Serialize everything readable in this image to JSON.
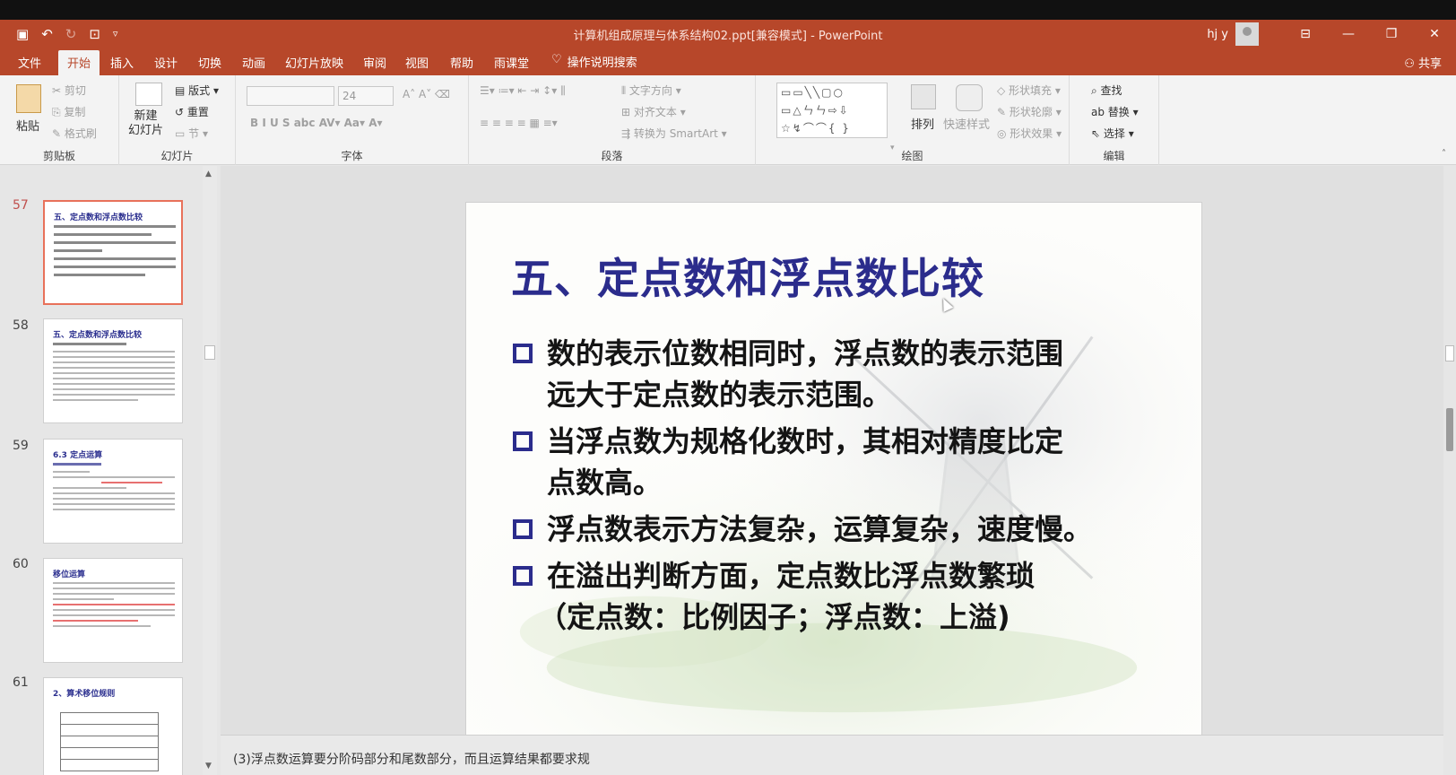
{
  "window": {
    "title": "计算机组成原理与体系结构02.ppt[兼容模式] - PowerPoint",
    "user": "hj y"
  },
  "tabs": [
    "文件",
    "开始",
    "插入",
    "设计",
    "切换",
    "动画",
    "幻灯片放映",
    "审阅",
    "视图",
    "帮助",
    "雨课堂"
  ],
  "tell_me": "操作说明搜索",
  "share": "共享",
  "ribbon": {
    "clipboard": {
      "paste": "粘贴",
      "cut": "剪切",
      "copy": "复制",
      "format_painter": "格式刷",
      "label": "剪贴板"
    },
    "slides": {
      "new_slide": "新建\n幻灯片",
      "layout": "版式",
      "reset": "重置",
      "section": "节",
      "label": "幻灯片"
    },
    "font": {
      "size": "24",
      "label": "字体"
    },
    "paragraph": {
      "text_direction": "文字方向",
      "align_text": "对齐文本",
      "smartart": "转换为 SmartArt",
      "label": "段落"
    },
    "drawing": {
      "arrange": "排列",
      "quick_styles": "快速样式",
      "shape_fill": "形状填充",
      "shape_outline": "形状轮廓",
      "shape_effects": "形状效果",
      "label": "绘图"
    },
    "editing": {
      "find": "查找",
      "replace": "替换",
      "select": "选择",
      "label": "编辑"
    }
  },
  "thumbnails": [
    {
      "num": "57",
      "title": "五、定点数和浮点数比较"
    },
    {
      "num": "58",
      "title": "五、定点数和浮点数比较"
    },
    {
      "num": "59",
      "title": "6.3 定点运算"
    },
    {
      "num": "60",
      "title": "移位运算"
    },
    {
      "num": "61",
      "title": "2、算术移位规则"
    }
  ],
  "slide": {
    "title": "五、定点数和浮点数比较",
    "bullets": [
      {
        "line1": "数的表示位数相同时，浮点数的表示范围",
        "line2": "远大于定点数的表示范围。"
      },
      {
        "line1": "当浮点数为规格化数时，其相对精度比定",
        "line2": "点数高。"
      },
      {
        "line1": "浮点数表示方法复杂，运算复杂，速度慢。",
        "line2": ""
      },
      {
        "line1": "在溢出判断方面，定点数比浮点数繁琐",
        "line2": "（定点数：比例因子；浮点数：上溢)"
      }
    ]
  },
  "notes": "(3)浮点数运算要分阶码部分和尾数部分，而且运算结果都要求规"
}
